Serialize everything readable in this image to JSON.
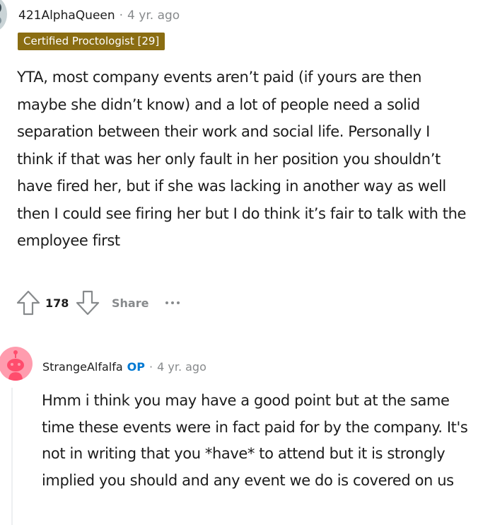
{
  "comment": {
    "author": "421AlphaQueen",
    "separator": "·",
    "time": "4 yr. ago",
    "flair": "Certified Proctologist [29]",
    "body": "YTA, most company events aren’t paid (if yours are then maybe she didn’t know) and a lot of people need a solid separation between their work and social life. Personally I think if that was her only fault in her position you shouldn’t have fired her, but if she was lacking in another way as well then I could see firing her but I do think it’s fair to talk with the employee first",
    "votes": "178",
    "share_label": "Share",
    "upvote_icon": "upvote-arrow-icon",
    "downvote_icon": "downvote-arrow-icon",
    "more_icon": "more-options-icon",
    "colors": {
      "flair_bg": "#8a6d12",
      "meta_gray": "#878a8c"
    }
  },
  "reply": {
    "author": "StrangeAlfalfa",
    "op_badge": "OP",
    "separator": "·",
    "time": "4 yr. ago",
    "avatar_icon": "snoo-avatar-icon",
    "body": "Hmm i think you may have a good point but at the same time these events were in fact paid for by the company. It's not in writing that you *have* to attend but it is strongly implied you should and any event we do is covered on us",
    "colors": {
      "avatar_bg": "#ff9cae",
      "op_blue": "#0079d3"
    }
  }
}
